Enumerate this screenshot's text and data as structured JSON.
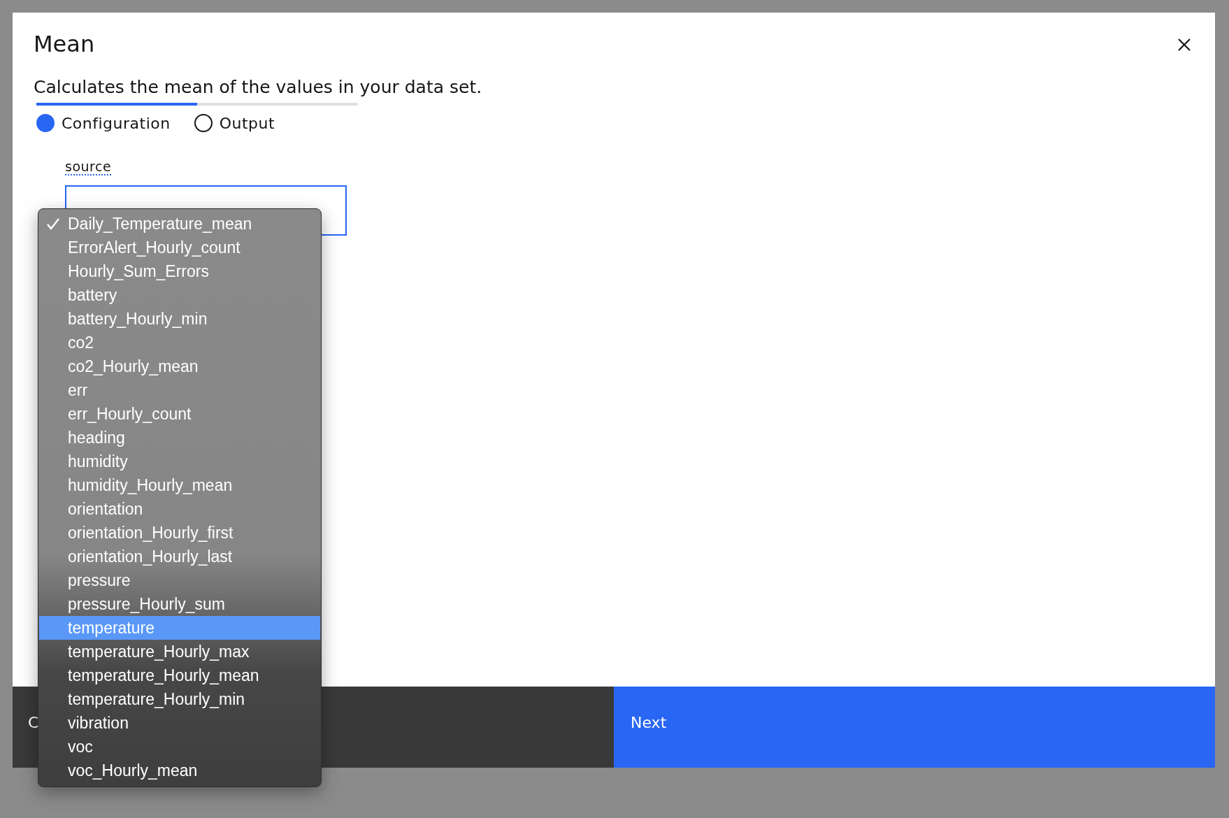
{
  "dialog": {
    "title": "Mean",
    "description": "Calculates the mean of the values in your data set."
  },
  "progress": {
    "level": 0.5
  },
  "steps": [
    {
      "label": "Configuration",
      "selected": true
    },
    {
      "label": "Output",
      "selected": false
    }
  ],
  "field": {
    "label": "source"
  },
  "dropdown": {
    "options": [
      {
        "label": "Daily_Temperature_mean",
        "checked": true,
        "selected": false
      },
      {
        "label": "ErrorAlert_Hourly_count",
        "checked": false,
        "selected": false
      },
      {
        "label": "Hourly_Sum_Errors",
        "checked": false,
        "selected": false
      },
      {
        "label": "battery",
        "checked": false,
        "selected": false
      },
      {
        "label": "battery_Hourly_min",
        "checked": false,
        "selected": false
      },
      {
        "label": "co2",
        "checked": false,
        "selected": false
      },
      {
        "label": "co2_Hourly_mean",
        "checked": false,
        "selected": false
      },
      {
        "label": "err",
        "checked": false,
        "selected": false
      },
      {
        "label": "err_Hourly_count",
        "checked": false,
        "selected": false
      },
      {
        "label": "heading",
        "checked": false,
        "selected": false
      },
      {
        "label": "humidity",
        "checked": false,
        "selected": false
      },
      {
        "label": "humidity_Hourly_mean",
        "checked": false,
        "selected": false
      },
      {
        "label": "orientation",
        "checked": false,
        "selected": false
      },
      {
        "label": "orientation_Hourly_first",
        "checked": false,
        "selected": false
      },
      {
        "label": "orientation_Hourly_last",
        "checked": false,
        "selected": false
      },
      {
        "label": "pressure",
        "checked": false,
        "selected": false
      },
      {
        "label": "pressure_Hourly_sum",
        "checked": false,
        "selected": false
      },
      {
        "label": "temperature",
        "checked": false,
        "selected": true
      },
      {
        "label": "temperature_Hourly_max",
        "checked": false,
        "selected": false
      },
      {
        "label": "temperature_Hourly_mean",
        "checked": false,
        "selected": false
      },
      {
        "label": "temperature_Hourly_min",
        "checked": false,
        "selected": false
      },
      {
        "label": "vibration",
        "checked": false,
        "selected": false
      },
      {
        "label": "voc",
        "checked": false,
        "selected": false
      },
      {
        "label": "voc_Hourly_mean",
        "checked": false,
        "selected": false
      }
    ]
  },
  "footer": {
    "secondary_button": "C",
    "primary_button": "Next"
  }
}
